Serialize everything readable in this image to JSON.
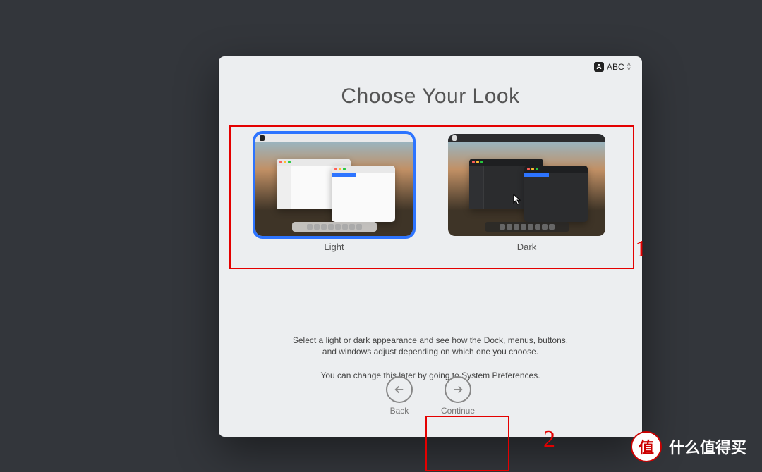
{
  "input_source": {
    "label": "ABC"
  },
  "title": "Choose Your Look",
  "themes": [
    {
      "id": "light",
      "label": "Light",
      "selected": true
    },
    {
      "id": "dark",
      "label": "Dark",
      "selected": false
    }
  ],
  "description": {
    "line1": "Select a light or dark appearance and see how the Dock, menus, buttons,",
    "line2": "and windows adjust depending on which one you choose.",
    "line3": "You can change this later by going to System Preferences."
  },
  "nav": {
    "back": "Back",
    "continue": "Continue"
  },
  "annotations": {
    "num1": "1",
    "num2": "2"
  },
  "watermark": {
    "badge": "值",
    "text": "什么值得买"
  }
}
